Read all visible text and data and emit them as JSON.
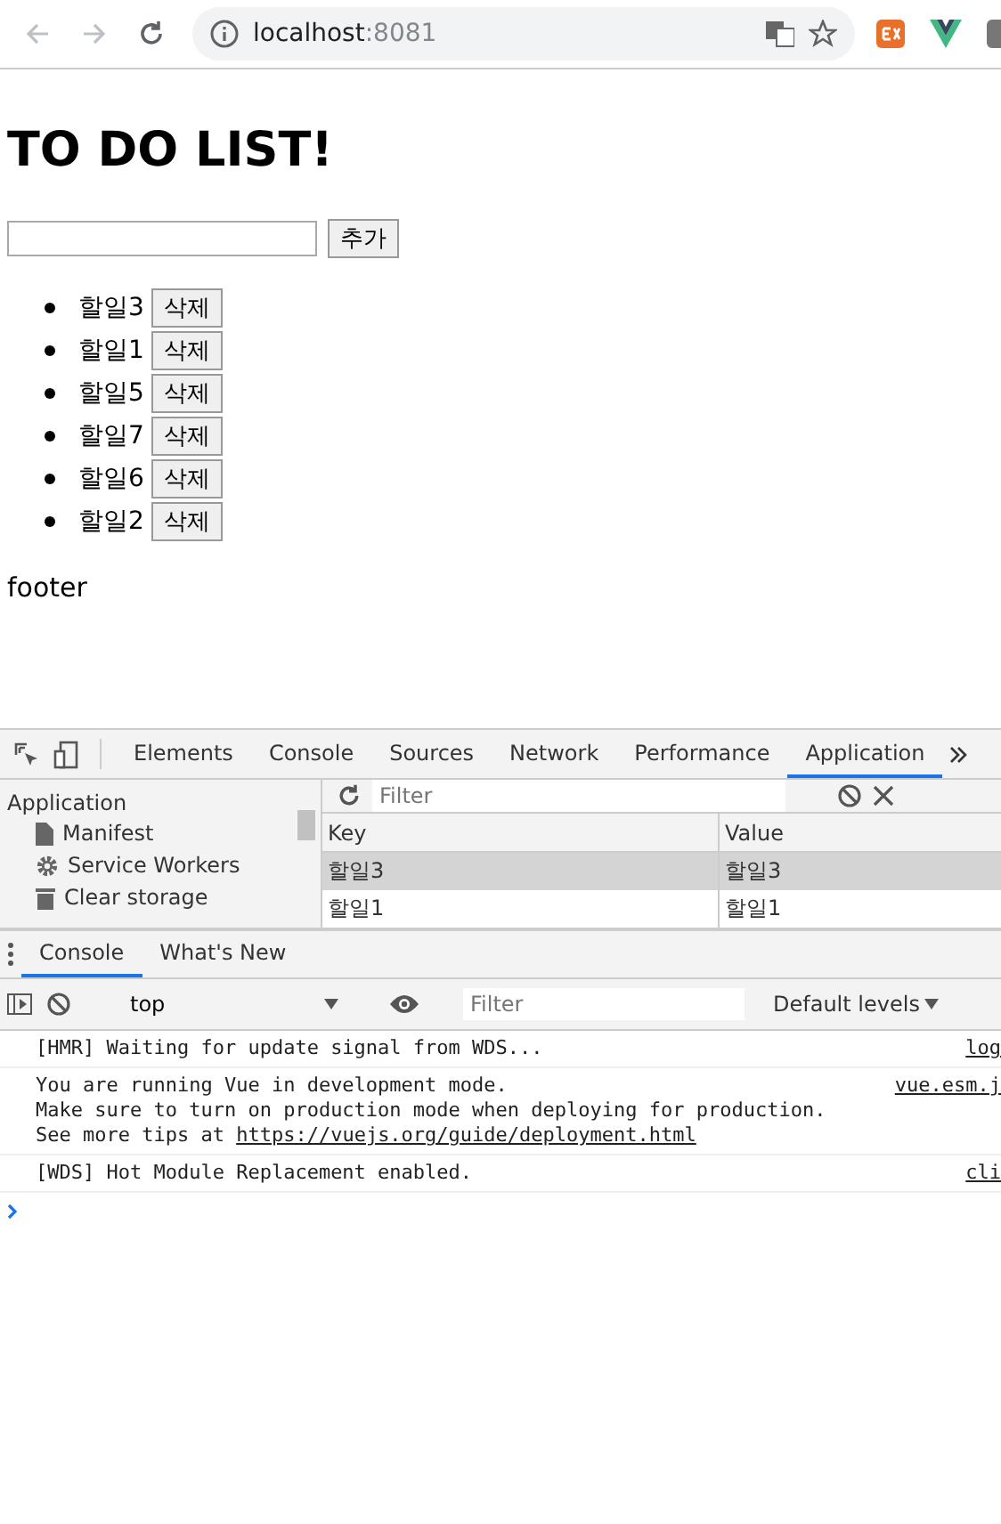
{
  "browser": {
    "nav": [
      {
        "kind": "back",
        "disabled": true
      },
      {
        "kind": "forward",
        "disabled": true
      },
      {
        "kind": "reload",
        "disabled": false
      }
    ],
    "address": {
      "host": "localhost",
      "port": ":8081"
    }
  },
  "page": {
    "title": "TO DO LIST!",
    "add_button": "추가",
    "todos": [
      {
        "text": "할일3",
        "button": "삭제"
      },
      {
        "text": "할일1",
        "button": "삭제"
      },
      {
        "text": "할일5",
        "button": "삭제"
      },
      {
        "text": "할일7",
        "button": "삭제"
      },
      {
        "text": "할일6",
        "button": "삭제"
      },
      {
        "text": "할일2",
        "button": "삭제"
      }
    ],
    "footer": "footer"
  },
  "devtools": {
    "tabs": [
      {
        "label": "Elements",
        "selected": false
      },
      {
        "label": "Console",
        "selected": false
      },
      {
        "label": "Sources",
        "selected": false
      },
      {
        "label": "Network",
        "selected": false
      },
      {
        "label": "Performance",
        "selected": false
      },
      {
        "label": "Application",
        "selected": true
      }
    ],
    "sidebar": {
      "heading": "Application",
      "items": [
        {
          "label": "Manifest",
          "kind": "manifest"
        },
        {
          "label": "Service Workers",
          "kind": "workers"
        },
        {
          "label": "Clear storage",
          "kind": "storage"
        }
      ]
    },
    "storage": {
      "filter_placeholder": "Filter",
      "columns": [
        "Key",
        "Value"
      ],
      "rows": [
        {
          "key": "할일3",
          "value": "할일3",
          "selected": true
        },
        {
          "key": "할일1",
          "value": "할일1",
          "selected": false
        }
      ]
    },
    "drawer": {
      "tabs": [
        {
          "label": "Console",
          "selected": true
        },
        {
          "label": "What's New",
          "selected": false
        }
      ],
      "context": "top",
      "filter_placeholder": "Filter",
      "levels": "Default levels",
      "messages": [
        {
          "lines": [
            "[HMR] Waiting for update signal from WDS..."
          ],
          "source": "log"
        },
        {
          "lines": [
            "You are running Vue in development mode.",
            "Make sure to turn on production mode when deploying for production."
          ],
          "link_line": {
            "text": "See more tips at ",
            "link": "https://vuejs.org/guide/deployment.html"
          },
          "source": "vue.esm.j"
        },
        {
          "lines": [
            "[WDS] Hot Module Replacement enabled."
          ],
          "source": "cli"
        }
      ]
    }
  }
}
